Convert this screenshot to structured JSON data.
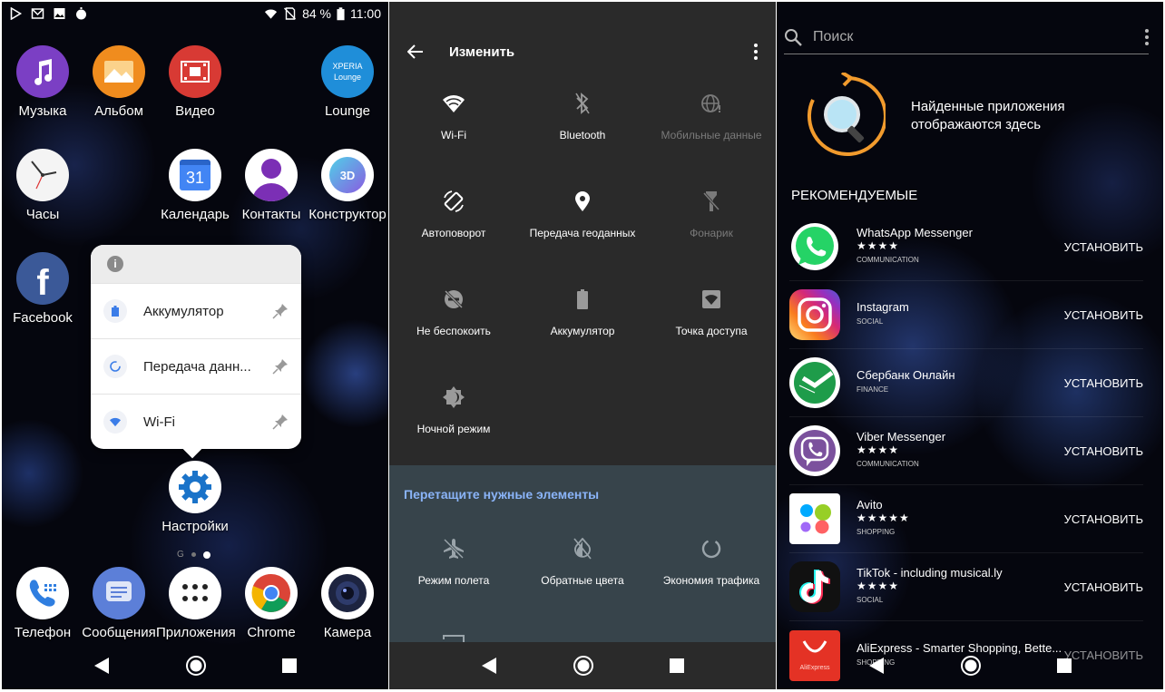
{
  "status": {
    "battery": "84 %",
    "time": "11:00"
  },
  "home": {
    "apps": [
      {
        "label": "Музыка",
        "color": "#7b3fc4"
      },
      {
        "label": "Альбом",
        "color": "#f08c1e"
      },
      {
        "label": "Видео",
        "color": "#d83a34"
      },
      {
        "label": "Lounge",
        "color": "#1f8ed9",
        "inner1": "XPERIA",
        "inner2": "Lounge"
      },
      {
        "label": "Часы",
        "color": "#f4f4f4"
      },
      {
        "label": "Календарь",
        "color": "#ffffff",
        "inner1": "31"
      },
      {
        "label": "Контакты",
        "color": "#ffffff"
      },
      {
        "label": "Конструктор",
        "color": "#ffffff",
        "inner1": "3D"
      },
      {
        "label": "Facebook",
        "color": "#3b5998"
      },
      {
        "label": "Настройки",
        "color": "#ffffff"
      },
      {
        "label": "Телефон",
        "color": "#ffffff"
      },
      {
        "label": "Сообщения",
        "color": "#5c7fd8"
      },
      {
        "label": "Приложения",
        "color": "#ffffff"
      },
      {
        "label": "Chrome",
        "color": "#ffffff"
      },
      {
        "label": "Камера",
        "color": "#ffffff"
      }
    ],
    "popup": {
      "items": [
        {
          "label": "Аккумулятор"
        },
        {
          "label": "Передача данн..."
        },
        {
          "label": "Wi-Fi"
        }
      ]
    },
    "page_dots_label": "G"
  },
  "qs": {
    "title": "Изменить",
    "tiles": [
      {
        "label": "Wi-Fi",
        "icon": "wifi-icon"
      },
      {
        "label": "Bluetooth",
        "icon": "bluetooth-icon"
      },
      {
        "label": "Мобильные данные",
        "icon": "mobile-data-icon"
      },
      {
        "label": "Автоповорот",
        "icon": "auto-rotate-icon"
      },
      {
        "label": "Передача геоданных",
        "icon": "location-icon"
      },
      {
        "label": "Фонарик",
        "icon": "flashlight-icon"
      },
      {
        "label": "Не беспокоить",
        "icon": "do-not-disturb-icon"
      },
      {
        "label": "Аккумулятор",
        "icon": "battery-icon"
      },
      {
        "label": "Точка доступа",
        "icon": "hotspot-icon"
      },
      {
        "label": "Ночной режим",
        "icon": "night-mode-icon"
      }
    ],
    "drag_title": "Перетащите нужные элементы",
    "extra_tiles": [
      {
        "label": "Режим полета",
        "icon": "airplane-icon"
      },
      {
        "label": "Обратные цвета",
        "icon": "invert-colors-icon"
      },
      {
        "label": "Экономия трафика",
        "icon": "data-saver-icon"
      }
    ]
  },
  "store": {
    "search_placeholder": "Поиск",
    "found_text_1": "Найденные приложения",
    "found_text_2": "отображаются здесь",
    "section_title": "РЕКОМЕНДУЕМЫЕ",
    "install_label": "УСТАНОВИТЬ",
    "apps": [
      {
        "name": "WhatsApp Messenger",
        "stars": "★★★★",
        "category": "COMMUNICATION",
        "color": "#25d366"
      },
      {
        "name": "Instagram",
        "stars": "",
        "category": "SOCIAL",
        "color": "#d62976"
      },
      {
        "name": "Сбербанк Онлайн",
        "stars": "",
        "category": "FINANCE",
        "color": "#ffffff"
      },
      {
        "name": "Viber Messenger",
        "stars": "★★★★",
        "category": "COMMUNICATION",
        "color": "#ffffff"
      },
      {
        "name": "Avito",
        "stars": "★★★★★",
        "category": "SHOPPING",
        "color": "#ffffff"
      },
      {
        "name": "TikTok - including musical.ly",
        "stars": "★★★★",
        "category": "SOCIAL",
        "color": "#111111"
      },
      {
        "name": "AliExpress - Smarter Shopping, Bette...",
        "stars": "",
        "category": "SHOPPING",
        "color": "#e43225",
        "inner": "AliExpress"
      }
    ]
  }
}
